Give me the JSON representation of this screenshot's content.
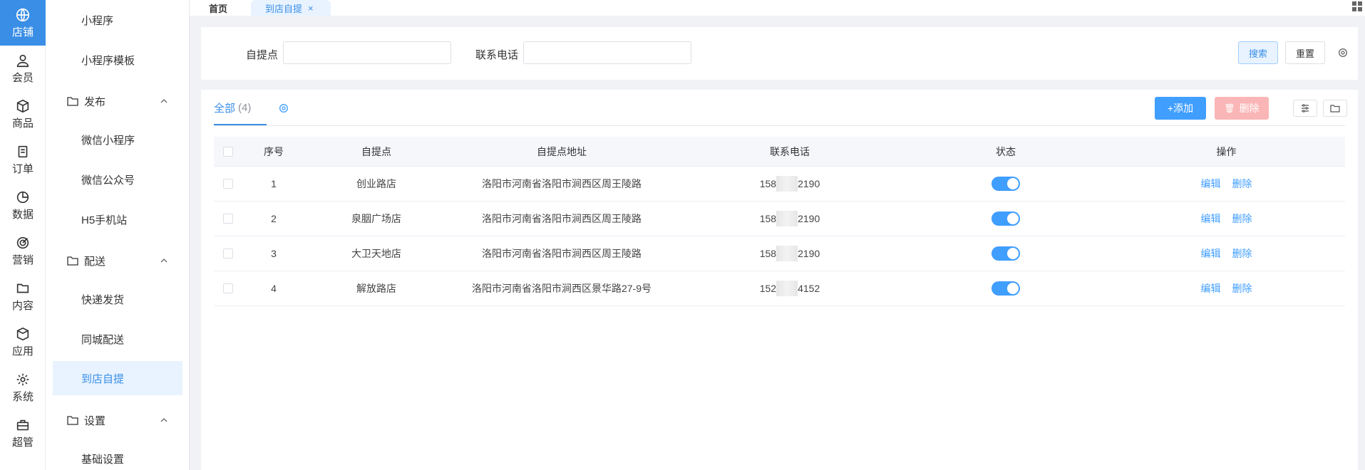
{
  "rail": [
    {
      "label": "店铺",
      "icon": "store-icon",
      "active": true
    },
    {
      "label": "会员",
      "icon": "user-icon"
    },
    {
      "label": "商品",
      "icon": "cube-icon"
    },
    {
      "label": "订单",
      "icon": "clipboard-icon"
    },
    {
      "label": "数据",
      "icon": "pie-chart-icon"
    },
    {
      "label": "营销",
      "icon": "target-icon"
    },
    {
      "label": "内容",
      "icon": "folder-icon"
    },
    {
      "label": "应用",
      "icon": "box-icon"
    },
    {
      "label": "系统",
      "icon": "gear-icon"
    },
    {
      "label": "超管",
      "icon": "toolbox-icon"
    }
  ],
  "submenu": {
    "items_top": [
      "小程序",
      "小程序模板"
    ],
    "group_publish": "发布",
    "publish_items": [
      "微信小程序",
      "微信公众号",
      "H5手机站"
    ],
    "group_delivery": "配送",
    "delivery_items": [
      "快递发货",
      "同城配送",
      "到店自提"
    ],
    "group_settings": "设置",
    "settings_items": [
      "基础设置"
    ]
  },
  "tabs": {
    "home": "首页",
    "current": "到店自提",
    "close": "×"
  },
  "search": {
    "label_point": "自提点",
    "label_phone": "联系电话",
    "point_value": "",
    "phone_value": "",
    "btn_search": "搜索",
    "btn_reset": "重置"
  },
  "panel": {
    "tab_all": "全部",
    "tab_count": "(4)",
    "btn_add": "+添加",
    "btn_delete": "删除"
  },
  "table": {
    "headers": [
      "序号",
      "自提点",
      "自提点地址",
      "联系电话",
      "状态",
      "操作"
    ],
    "rows": [
      {
        "no": "1",
        "name": "创业路店",
        "addr": "洛阳市河南省洛阳市涧西区周王陵路",
        "tel_a": "158",
        "tel_b": "2190",
        "on": true
      },
      {
        "no": "2",
        "name": "泉胭广场店",
        "addr": "洛阳市河南省洛阳市涧西区周王陵路",
        "tel_a": "158",
        "tel_b": "2190",
        "on": true
      },
      {
        "no": "3",
        "name": "大卫天地店",
        "addr": "洛阳市河南省洛阳市涧西区周王陵路",
        "tel_a": "158",
        "tel_b": "2190",
        "on": true
      },
      {
        "no": "4",
        "name": "解放路店",
        "addr": "洛阳市河南省洛阳市涧西区景华路27-9号",
        "tel_a": "152",
        "tel_b": "4152",
        "on": true
      }
    ],
    "op_edit": "编辑",
    "op_delete": "删除"
  },
  "colors": {
    "primary": "#409eff",
    "danger_disabled": "#fab6b6",
    "active_bg": "#e8f3ff"
  }
}
